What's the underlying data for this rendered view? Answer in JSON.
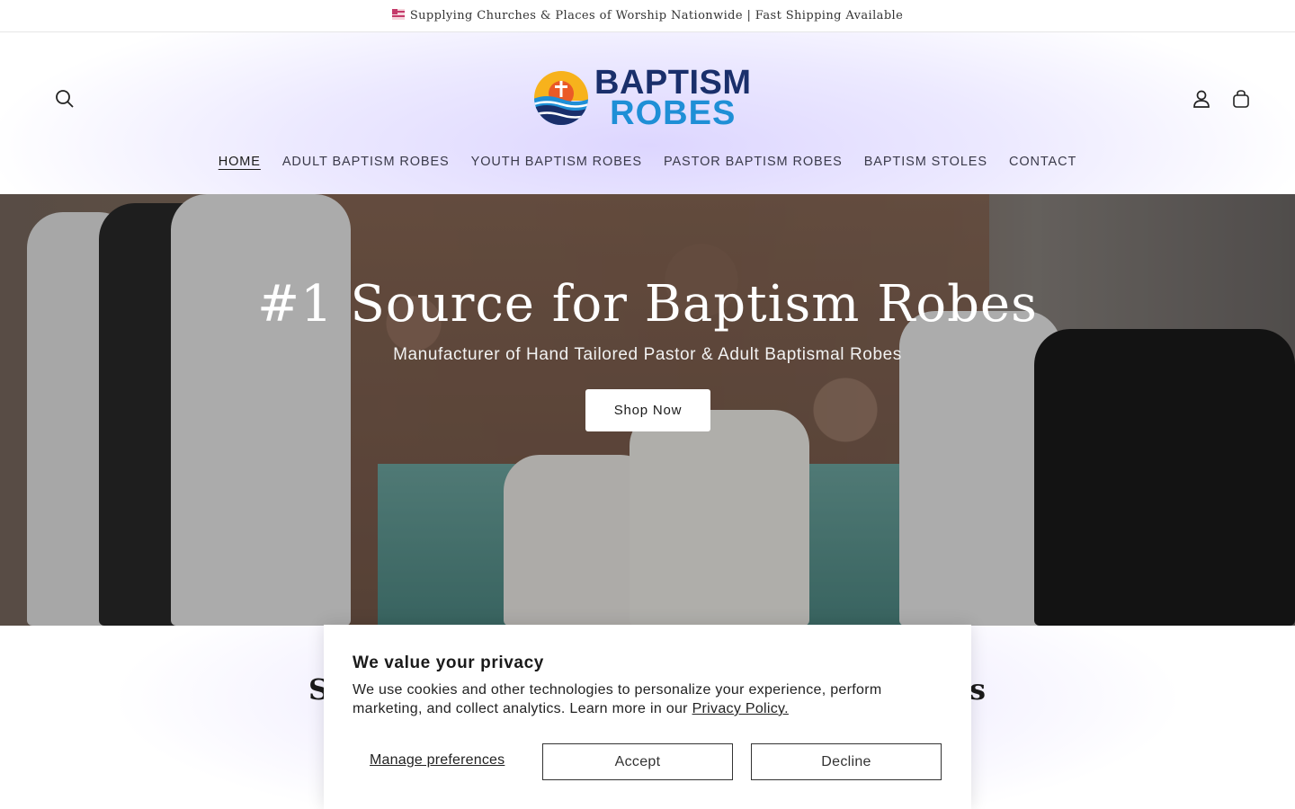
{
  "announcement": {
    "icon": "flag-icon",
    "text": "Supplying Churches & Places of Worship Nationwide | Fast Shipping Available"
  },
  "header": {
    "logo": {
      "line1": "BAPTISM",
      "line2": "ROBES"
    },
    "icons": [
      "search-icon",
      "account-icon",
      "cart-icon"
    ]
  },
  "nav": {
    "items": [
      {
        "label": "HOME",
        "active": true
      },
      {
        "label": "ADULT BAPTISM ROBES"
      },
      {
        "label": "YOUTH BAPTISM ROBES"
      },
      {
        "label": "PASTOR BAPTISM ROBES"
      },
      {
        "label": "BAPTISM STOLES"
      },
      {
        "label": "CONTACT"
      }
    ]
  },
  "hero": {
    "title": "#1 Source for Baptism Robes",
    "subtitle": "Manufacturer of Hand Tailored Pastor & Adult Baptismal Robes",
    "cta": "Shop Now"
  },
  "section": {
    "heading_left": "S",
    "heading_right": "s"
  },
  "cookie_banner": {
    "title": "We value your privacy",
    "text": "We use cookies and other technologies to personalize your experience, perform marketing, and collect analytics. Learn more in our",
    "link": "Privacy Policy.",
    "manage": "Manage preferences",
    "accept": "Accept",
    "decline": "Decline"
  },
  "colors": {
    "logo_dark": "#1a2f6b",
    "logo_blue": "#1f8fd6",
    "header_glow": "#ddd6ff"
  }
}
